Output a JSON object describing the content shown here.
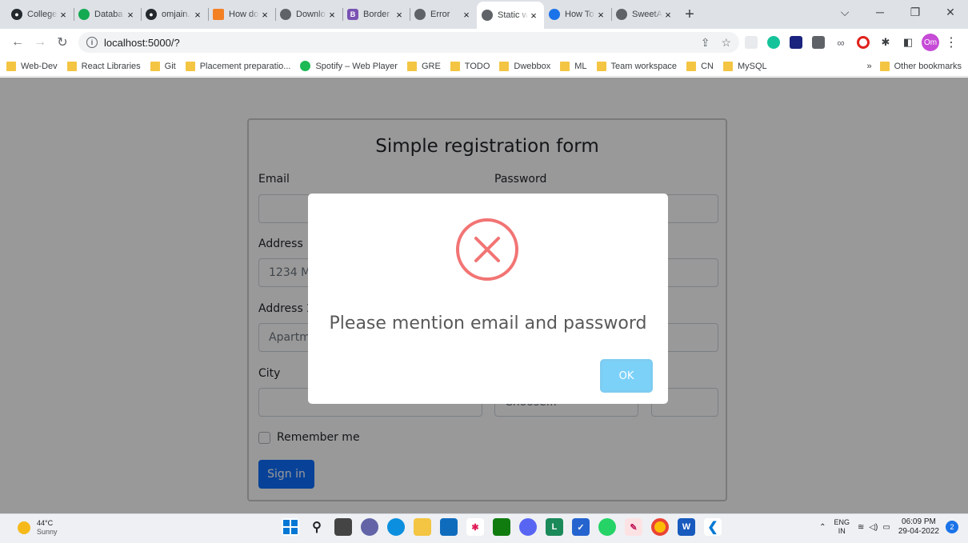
{
  "browser": {
    "tabs": [
      {
        "title": "College",
        "icon": "github-icon",
        "color": "#24292e"
      },
      {
        "title": "Databa",
        "icon": "mongodb-icon",
        "color": "#13aa52"
      },
      {
        "title": "omjain.",
        "icon": "github-icon",
        "color": "#24292e"
      },
      {
        "title": "How do",
        "icon": "stackoverflow-icon",
        "color": "#f48024"
      },
      {
        "title": "Downlo",
        "icon": "globe-icon",
        "color": "#5f6368"
      },
      {
        "title": "Border",
        "icon": "bootstrap-icon",
        "color": "#7952b3"
      },
      {
        "title": "Error",
        "icon": "globe-icon",
        "color": "#5f6368"
      },
      {
        "title": "Static w",
        "icon": "globe-icon",
        "color": "#5f6368"
      },
      {
        "title": "How To",
        "icon": "refresh-icon",
        "color": "#1a73e8"
      },
      {
        "title": "SweetA",
        "icon": "globe-icon",
        "color": "#5f6368"
      }
    ],
    "new_tab": "+",
    "url": "localhost:5000/?",
    "profile_initials": "Om"
  },
  "bookmarks": {
    "items": [
      "Web-Dev",
      "React Libraries",
      "Git",
      "Placement preparatio...",
      "Spotify – Web Player",
      "GRE",
      "TODO",
      "Dwebbox",
      "ML",
      "Team workspace",
      "CN",
      "MySQL"
    ],
    "more": "»",
    "other": "Other bookmarks"
  },
  "form": {
    "title": "Simple registration form",
    "email_label": "Email",
    "password_label": "Password",
    "address_label": "Address",
    "address_placeholder": "1234 M",
    "address2_label": "Address 2",
    "address2_placeholder": "Apartm",
    "city_label": "City",
    "state_placeholder": "Choose...",
    "remember_label": "Remember me",
    "signin_label": "Sign in"
  },
  "alert": {
    "icon": "error-x-icon",
    "message": "Please mention email and password",
    "ok_label": "OK",
    "icon_color": "#f27474",
    "ok_color": "#7cd1f9"
  },
  "taskbar": {
    "temperature": "44°C",
    "condition": "Sunny",
    "lang1": "ENG",
    "lang2": "IN",
    "time": "06:09 PM",
    "date": "29-04-2022",
    "notifications": "2"
  }
}
